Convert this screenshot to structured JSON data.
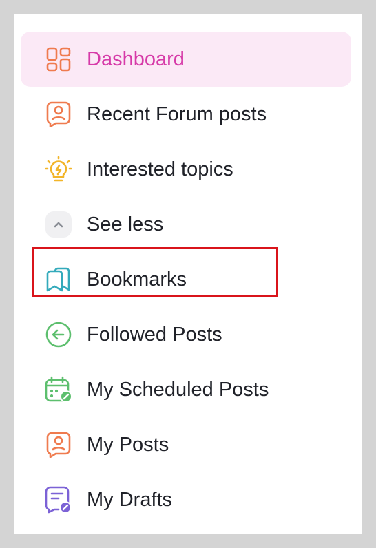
{
  "nav": {
    "items": [
      {
        "label": "Dashboard",
        "icon": "dashboard-icon",
        "active": true
      },
      {
        "label": "Recent Forum posts",
        "icon": "user-chat-icon"
      },
      {
        "label": "Interested topics",
        "icon": "lightbulb-icon"
      },
      {
        "label": "See less",
        "icon": "chevron-up-icon"
      },
      {
        "label": "Bookmarks",
        "icon": "bookmark-icon",
        "highlighted": true
      },
      {
        "label": "Followed Posts",
        "icon": "arrow-left-circle-icon"
      },
      {
        "label": "My Scheduled Posts",
        "icon": "calendar-edit-icon"
      },
      {
        "label": "My Posts",
        "icon": "user-chat-icon"
      },
      {
        "label": "My Drafts",
        "icon": "draft-edit-icon"
      }
    ]
  },
  "colors": {
    "active_bg": "#fbe9f6",
    "active_text": "#d63aa8",
    "orange_icon": "#ef7b4f",
    "yellow_icon": "#f2b529",
    "teal_icon": "#33aabb",
    "green_icon": "#5dbf6e",
    "purple_icon": "#7c62d6",
    "highlight_border": "#d9141b"
  }
}
